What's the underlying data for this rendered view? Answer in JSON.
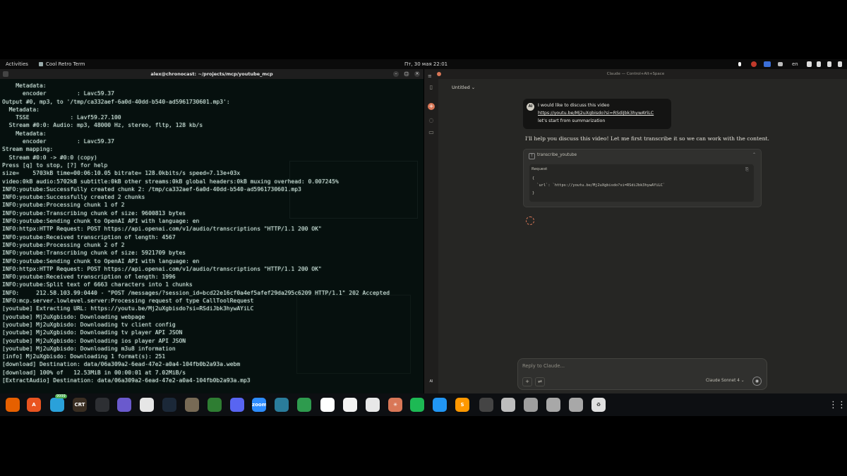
{
  "topbar": {
    "activities": "Activities",
    "app_name": "Cool Retro Term",
    "clock": "Пт, 30 мая  22:01",
    "lang": "en"
  },
  "terminal": {
    "title": "alex@chronocast: ~/projects/mcp/youtube_mcp",
    "lines": [
      "    Metadata:",
      "      encoder         : Lavc59.37",
      "Output #0, mp3, to '/tmp/ca332aef-6a0d-40dd-b540-ad5961730601.mp3':",
      "  Metadata:",
      "    TSSE            : Lavf59.27.100",
      "  Stream #0:0: Audio: mp3, 48000 Hz, stereo, fltp, 128 kb/s",
      "    Metadata:",
      "      encoder         : Lavc59.37",
      "Stream mapping:",
      "  Stream #0:0 -> #0:0 (copy)",
      "Press [q] to stop, [?] for help",
      "size=    5703kB time=00:06:10.05 bitrate= 128.0kbits/s speed=7.13e+03x",
      "video:0kB audio:5702kB subtitle:0kB other streams:0kB global headers:0kB muxing overhead: 0.007245%",
      "INFO:youtube:Successfully created chunk 2: /tmp/ca332aef-6a0d-40dd-b540-ad5961730601.mp3",
      "INFO:youtube:Successfully created 2 chunks",
      "INFO:youtube:Processing chunk 1 of 2",
      "INFO:youtube:Transcribing chunk of size: 9600813 bytes",
      "INFO:youtube:Sending chunk to OpenAI API with language: en",
      "INFO:httpx:HTTP Request: POST https://api.openai.com/v1/audio/transcriptions \"HTTP/1.1 200 OK\"",
      "INFO:youtube:Received transcription of length: 4567",
      "INFO:youtube:Processing chunk 2 of 2",
      "INFO:youtube:Transcribing chunk of size: 5921709 bytes",
      "INFO:youtube:Sending chunk to OpenAI API with language: en",
      "INFO:httpx:HTTP Request: POST https://api.openai.com/v1/audio/transcriptions \"HTTP/1.1 200 OK\"",
      "INFO:youtube:Received transcription of length: 1996",
      "INFO:youtube:Split text of 6663 characters into 1 chunks",
      "INFO:     212.58.103.99:0440 - \"POST /messages/?session_id=bcd22e16cf0a4ef5afef29da295c6209 HTTP/1.1\" 202 Accepted",
      "INFO:mcp.server.lowlevel.server:Processing request of type CallToolRequest",
      "[youtube] Extracting URL: https://youtu.be/Mj2uXgbisdo?si=RSdiJbk3hywAYiLC",
      "[youtube] Mj2uXgbisdo: Downloading webpage",
      "[youtube] Mj2uXgbisdo: Downloading tv client config",
      "[youtube] Mj2uXgbisdo: Downloading tv player API JSON",
      "[youtube] Mj2uXgbisdo: Downloading ios player API JSON",
      "[youtube] Mj2uXgbisdo: Downloading m3u8 information",
      "[info] Mj2uXgbisdo: Downloading 1 format(s): 251",
      "[download] Destination: data/06a309a2-6ead-47e2-a0a4-104fb0b2a93a.webm",
      "[download] 100% of   12.53MiB in 00:00:01 at 7.02MiB/s",
      "[ExtractAudio] Destination: data/06a309a2-6ead-47e2-a0a4-104fb0b2a93a.mp3"
    ]
  },
  "claude": {
    "window_title": "Claude — Control+Alt+Space",
    "chat_title": "Untitled ⌄",
    "user_avatar": "AI",
    "user_msg_line1": "I would like to discuss this video",
    "user_msg_link": "https://youtu.be/Mj2uXgbisdo?si=RSdiJbk3hywAYiLC",
    "user_msg_line3": "let's start from summarization",
    "assistant_text": "I'll help you discuss this video! Let me first transcribe it so we can work with the content.",
    "tool_name": "transcribe_youtube",
    "request_label": "Request",
    "request_code": {
      "open": "{",
      "line": "  `url`: `https://youtu.be/Mj2uXgbisdo?si=RSdiJbk3hywAYiLC`",
      "close": "}"
    },
    "composer_placeholder": "Reply to Claude...",
    "model": "Claude Sonnet 4 ⌄",
    "rail_bottom": "AI"
  },
  "dock": {
    "apps": [
      {
        "icon": "firefox-icon",
        "label": "",
        "color": "#e66000"
      },
      {
        "icon": "app-center-icon",
        "label": "A",
        "color": "#e95420"
      },
      {
        "icon": "telegram-icon",
        "label": "",
        "color": "#2aa1da"
      },
      {
        "icon": "cool-retro-term-icon",
        "label": "CRT",
        "color": "#3a2e22"
      },
      {
        "icon": "system-monitor-icon",
        "label": "",
        "color": "#2d2f33"
      },
      {
        "icon": "file-roller-icon",
        "label": "",
        "color": "#6a5acd"
      },
      {
        "icon": "speech-bubble-icon",
        "label": "",
        "color": "#e6e6e6"
      },
      {
        "icon": "steam-icon",
        "label": "",
        "color": "#1b2838"
      },
      {
        "icon": "gimp-icon",
        "label": "",
        "color": "#776a55"
      },
      {
        "icon": "globe-icon",
        "label": "",
        "color": "#2e7d32"
      },
      {
        "icon": "discord-icon",
        "label": "",
        "color": "#5865f2"
      },
      {
        "icon": "zoom-icon",
        "label": "zoom",
        "color": "#2d8cff"
      },
      {
        "icon": "panel-icon",
        "label": "",
        "color": "#2a7c9b"
      },
      {
        "icon": "libreoffice-calc-icon",
        "label": "",
        "color": "#2e9b4e"
      },
      {
        "icon": "inkscape-icon",
        "label": "",
        "color": "#ffffff"
      },
      {
        "icon": "inkscape-alt-icon",
        "label": "",
        "color": "#f2f2f2"
      },
      {
        "icon": "package-icon",
        "label": "",
        "color": "#e8e8e8"
      },
      {
        "icon": "claude-icon",
        "label": "✳",
        "color": "#d97757"
      },
      {
        "icon": "spotify-icon",
        "label": "",
        "color": "#1db954"
      },
      {
        "icon": "send-icon",
        "label": "",
        "color": "#2196f3"
      },
      {
        "icon": "sublime-text-icon",
        "label": "S",
        "color": "#ff9800"
      },
      {
        "icon": "cube-icon",
        "label": "",
        "color": "#444444"
      },
      {
        "icon": "files-icon",
        "label": "",
        "color": "#bdbdbd"
      },
      {
        "icon": "disk-icon",
        "label": "",
        "color": "#9e9e9e"
      },
      {
        "icon": "drive-icon",
        "label": "",
        "color": "#a8a8a8"
      },
      {
        "icon": "drive-2-icon",
        "label": "",
        "color": "#a8a8a8"
      },
      {
        "icon": "trash-icon",
        "label": "♻",
        "color": "#e0e0e0"
      }
    ],
    "badge": "9999"
  },
  "colors": {
    "terminal_bg": "#06100e",
    "terminal_text": "#d8e8e2",
    "claude_bg": "#262624",
    "claude_accent": "#d97757"
  }
}
